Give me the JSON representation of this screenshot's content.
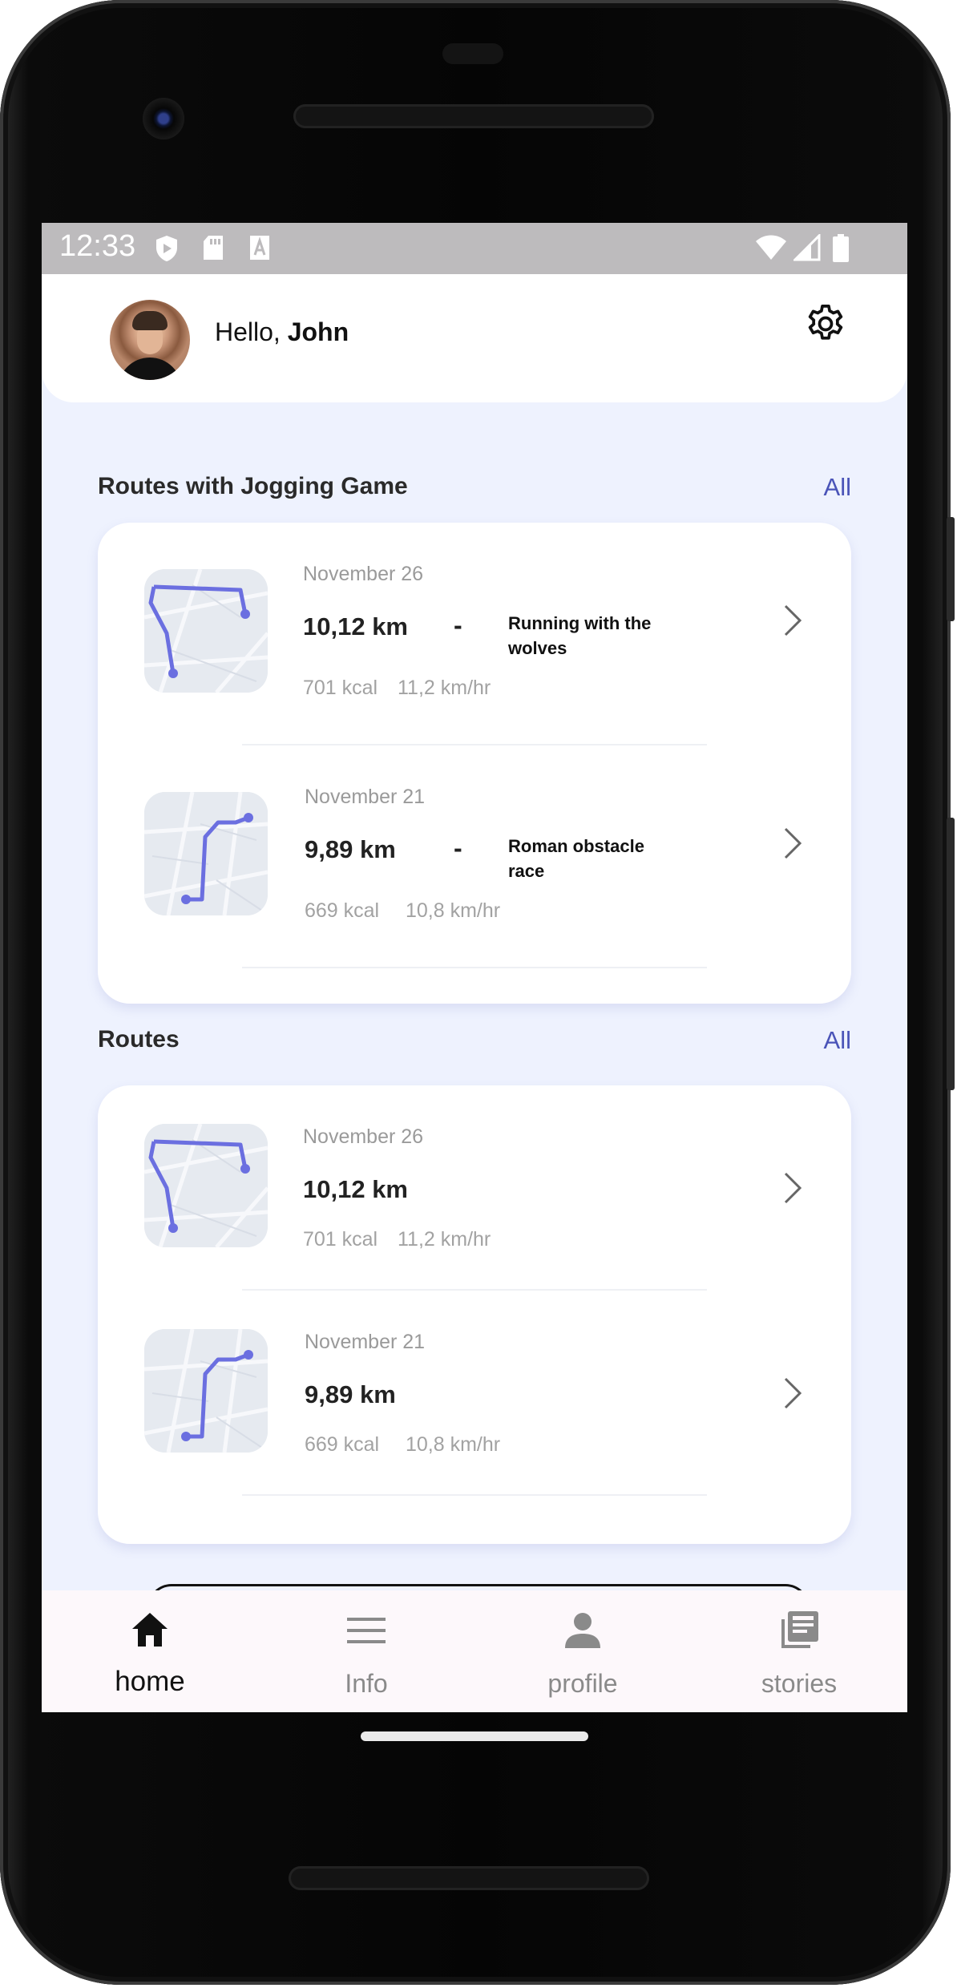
{
  "status_bar": {
    "time": "12:33",
    "icons": [
      "shield-icon",
      "sd-card-icon",
      "a-icon",
      "wifi-icon",
      "signal-icon",
      "battery-icon"
    ]
  },
  "header": {
    "greeting_prefix": "Hello, ",
    "user_name": "John",
    "settings_icon": "gear-icon"
  },
  "sections": {
    "jogging": {
      "title": "Routes with Jogging Game",
      "all_label": "All",
      "items": [
        {
          "date": "November 26",
          "distance": "10,12 km",
          "separator": "-",
          "game": "Running with the wolves",
          "kcal": "701 kcal",
          "speed": "11,2 km/hr"
        },
        {
          "date": "November 21",
          "distance": "9,89 km",
          "separator": "-",
          "game": "Roman obstacle race",
          "kcal": "669 kcal",
          "speed": "10,8 km/hr"
        }
      ]
    },
    "routes": {
      "title": "Routes",
      "all_label": "All",
      "items": [
        {
          "date": "November 26",
          "distance": "10,12 km",
          "kcal": "701 kcal",
          "speed": "11,2 km/hr"
        },
        {
          "date": "November 21",
          "distance": "9,89 km",
          "kcal": "669 kcal",
          "speed": "10,8 km/hr"
        }
      ]
    }
  },
  "nav": {
    "items": [
      {
        "label": "home",
        "icon": "home-icon",
        "active": true
      },
      {
        "label": "Info",
        "icon": "menu-icon",
        "active": false
      },
      {
        "label": "profile",
        "icon": "person-icon",
        "active": false
      },
      {
        "label": "stories",
        "icon": "library-icon",
        "active": false
      }
    ]
  },
  "colors": {
    "accent": "#4a54b8",
    "route": "#6b6fe0",
    "screen_bg": "#eef2fe",
    "status_bar": "#bdbbbd",
    "nav_bg": "#fdf8fb"
  }
}
